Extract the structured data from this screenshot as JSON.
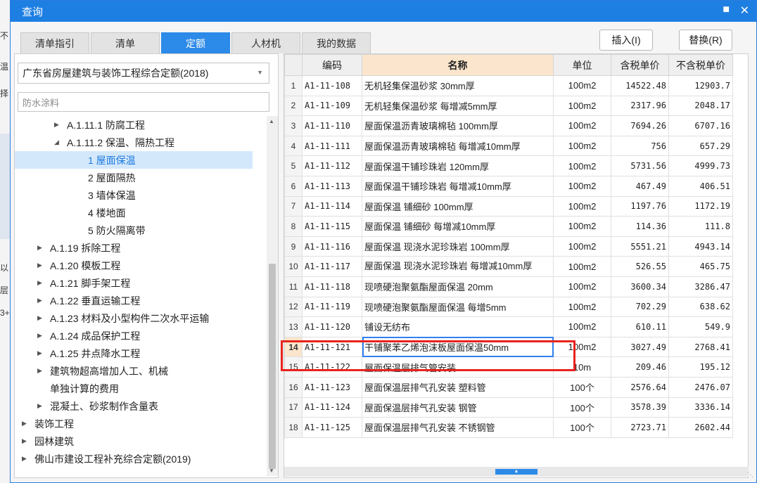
{
  "window": {
    "title": "查询",
    "restore_icon": "restore-icon",
    "close_icon": "close-icon"
  },
  "behind": {
    "fragments": [
      "不",
      "温",
      "择",
      "温",
      "以",
      "层",
      "3+"
    ]
  },
  "tabs": [
    {
      "label": "清单指引",
      "active": false
    },
    {
      "label": "清单",
      "active": false
    },
    {
      "label": "定额",
      "active": true
    },
    {
      "label": "人材机",
      "active": false
    },
    {
      "label": "我的数据",
      "active": false
    }
  ],
  "actions": {
    "insert": "插入(I)",
    "replace": "替换(R)"
  },
  "left": {
    "selected_book": "广东省房屋建筑与装饰工程综合定额(2018)",
    "search_value": "防水涂料",
    "tree": [
      {
        "label": "A.1.11.1 防腐工程",
        "state": "collapsed",
        "level": 2
      },
      {
        "label": "A.1.11.2 保温、隔热工程",
        "state": "expanded",
        "level": 2
      },
      {
        "label": "1 屋面保温",
        "state": "leaf",
        "level": 3,
        "selected": true
      },
      {
        "label": "2 屋面隔热",
        "state": "leaf",
        "level": 3
      },
      {
        "label": "3 墙体保温",
        "state": "leaf",
        "level": 3
      },
      {
        "label": "4 楼地面",
        "state": "leaf",
        "level": 3
      },
      {
        "label": "5 防火隔离带",
        "state": "leaf",
        "level": 3
      },
      {
        "label": "A.1.19 拆除工程",
        "state": "collapsed",
        "level": 1
      },
      {
        "label": "A.1.20 模板工程",
        "state": "collapsed",
        "level": 1
      },
      {
        "label": "A.1.21 脚手架工程",
        "state": "collapsed",
        "level": 1
      },
      {
        "label": "A.1.22 垂直运输工程",
        "state": "collapsed",
        "level": 1
      },
      {
        "label": "A.1.23 材料及小型构件二次水平运输",
        "state": "collapsed",
        "level": 1
      },
      {
        "label": "A.1.24 成品保护工程",
        "state": "collapsed",
        "level": 1
      },
      {
        "label": "A.1.25 井点降水工程",
        "state": "collapsed",
        "level": 1
      },
      {
        "label": "建筑物超高增加人工、机械",
        "state": "collapsed",
        "level": 1
      },
      {
        "label": "单独计算的费用",
        "state": "none",
        "level": 1
      },
      {
        "label": "混凝土、砂浆制作含量表",
        "state": "collapsed",
        "level": 1
      },
      {
        "label": "装饰工程",
        "state": "collapsed",
        "level": 0
      },
      {
        "label": "园林建筑",
        "state": "collapsed",
        "level": 0
      },
      {
        "label": "佛山市建设工程补充综合定额(2019)",
        "state": "collapsed",
        "level": 0
      }
    ]
  },
  "table": {
    "headers": [
      "编码",
      "名称",
      "单位",
      "含税单价",
      "不含税单价"
    ],
    "current_row": 14,
    "rows": [
      {
        "no": "1",
        "code": "A1-11-108",
        "name": "无机轻集保温砂浆 30mm厚",
        "unit": "100m2",
        "tax_price": "14522.48",
        "notax_price": "12903.7"
      },
      {
        "no": "2",
        "code": "A1-11-109",
        "name": "无机轻集保温砂浆 每增减5mm厚",
        "unit": "100m2",
        "tax_price": "2317.96",
        "notax_price": "2048.17"
      },
      {
        "no": "3",
        "code": "A1-11-110",
        "name": "屋面保温沥青玻璃棉毡 100mm厚",
        "unit": "100m2",
        "tax_price": "7694.26",
        "notax_price": "6707.16"
      },
      {
        "no": "4",
        "code": "A1-11-111",
        "name": "屋面保温沥青玻璃棉毡 每增减10mm厚",
        "unit": "100m2",
        "tax_price": "756",
        "notax_price": "657.29"
      },
      {
        "no": "5",
        "code": "A1-11-112",
        "name": "屋面保温干铺珍珠岩 120mm厚",
        "unit": "100m2",
        "tax_price": "5731.56",
        "notax_price": "4999.73"
      },
      {
        "no": "6",
        "code": "A1-11-113",
        "name": "屋面保温干铺珍珠岩 每增减10mm厚",
        "unit": "100m2",
        "tax_price": "467.49",
        "notax_price": "406.51"
      },
      {
        "no": "7",
        "code": "A1-11-114",
        "name": "屋面保温 铺细砂 100mm厚",
        "unit": "100m2",
        "tax_price": "1197.76",
        "notax_price": "1172.19"
      },
      {
        "no": "8",
        "code": "A1-11-115",
        "name": "屋面保温 铺细砂 每增减10mm厚",
        "unit": "100m2",
        "tax_price": "114.36",
        "notax_price": "111.8"
      },
      {
        "no": "9",
        "code": "A1-11-116",
        "name": "屋面保温 现浇水泥珍珠岩 100mm厚",
        "unit": "100m2",
        "tax_price": "5551.21",
        "notax_price": "4943.14"
      },
      {
        "no": "10",
        "code": "A1-11-117",
        "name": "屋面保温 现浇水泥珍珠岩 每增减10mm厚",
        "unit": "100m2",
        "tax_price": "526.55",
        "notax_price": "465.75"
      },
      {
        "no": "11",
        "code": "A1-11-118",
        "name": "现喷硬泡聚氨酯屋面保温 20mm",
        "unit": "100m2",
        "tax_price": "3600.34",
        "notax_price": "3286.47"
      },
      {
        "no": "12",
        "code": "A1-11-119",
        "name": "现喷硬泡聚氨酯屋面保温 每增5mm",
        "unit": "100m2",
        "tax_price": "702.29",
        "notax_price": "638.62"
      },
      {
        "no": "13",
        "code": "A1-11-120",
        "name": "铺设无纺布",
        "unit": "100m2",
        "tax_price": "610.11",
        "notax_price": "549.9"
      },
      {
        "no": "14",
        "code": "A1-11-121",
        "name": "干铺聚苯乙烯泡沫板屋面保温50mm",
        "unit": "100m2",
        "tax_price": "3027.49",
        "notax_price": "2768.41"
      },
      {
        "no": "15",
        "code": "A1-11-122",
        "name": "屋面保温层排气管安装",
        "unit": "10m",
        "tax_price": "209.46",
        "notax_price": "195.12"
      },
      {
        "no": "16",
        "code": "A1-11-123",
        "name": "屋面保温层排气孔安装 塑料管",
        "unit": "100个",
        "tax_price": "2576.64",
        "notax_price": "2476.07"
      },
      {
        "no": "17",
        "code": "A1-11-124",
        "name": "屋面保温层排气孔安装 钢管",
        "unit": "100个",
        "tax_price": "3578.39",
        "notax_price": "3336.14"
      },
      {
        "no": "18",
        "code": "A1-11-125",
        "name": "屋面保温层排气孔安装 不锈钢管",
        "unit": "100个",
        "tax_price": "2723.71",
        "notax_price": "2602.44"
      }
    ]
  },
  "colors": {
    "title_bar": "#1e7fe3",
    "active_tab": "#2c8ae8",
    "highlight_box": "#e8231d",
    "header_highlight": "#fbe5cc"
  }
}
